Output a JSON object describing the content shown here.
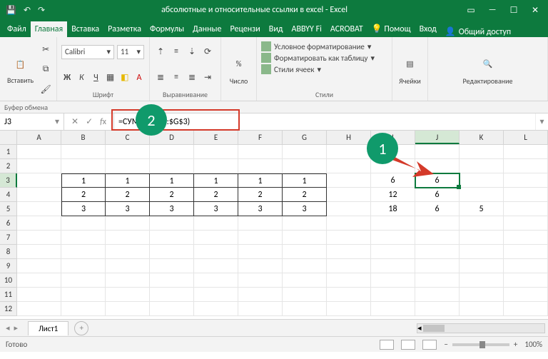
{
  "window": {
    "title": "абсолютные и относительные ссылки в excel - Excel"
  },
  "tabs": {
    "file": "Файл",
    "home": "Главная",
    "insert": "Вставка",
    "layout": "Разметка",
    "formulas": "Формулы",
    "data": "Данные",
    "review": "Рецензи",
    "view": "Вид",
    "abbyy": "ABBYY Fi",
    "acrobat": "ACROBAT",
    "help": "Помощ",
    "login": "Вход",
    "share": "Общий доступ"
  },
  "ribbon": {
    "clipboard": {
      "label": "Буфер обмена",
      "paste": "Вставить"
    },
    "font": {
      "label": "Шрифт",
      "name": "Calibri",
      "size": "11"
    },
    "alignment": {
      "label": "Выравнивание"
    },
    "number": {
      "label": "Число"
    },
    "styles": {
      "label": "Стили",
      "conditional": "Условное форматирование",
      "table": "Форматировать как таблицу",
      "cellstyles": "Стили ячеек"
    },
    "cells": {
      "label": "Ячейки"
    },
    "editing": {
      "label": "Редактирование"
    }
  },
  "namebox": "J3",
  "formula": "=СУММ($B$3:$G$3)",
  "columns": [
    "A",
    "B",
    "C",
    "D",
    "E",
    "F",
    "G",
    "H",
    "I",
    "J",
    "K",
    "L"
  ],
  "rows_count": 12,
  "grid": {
    "3": {
      "B": "1",
      "C": "1",
      "D": "1",
      "E": "1",
      "F": "1",
      "G": "1",
      "I": "6",
      "J": "6"
    },
    "4": {
      "B": "2",
      "C": "2",
      "D": "2",
      "E": "2",
      "F": "2",
      "G": "2",
      "I": "12",
      "J": "6"
    },
    "5": {
      "B": "3",
      "C": "3",
      "D": "3",
      "E": "3",
      "F": "3",
      "G": "3",
      "I": "18",
      "J": "6",
      "K": "5"
    }
  },
  "active_cell": "J3",
  "sheet": {
    "name": "Лист1"
  },
  "status": {
    "ready": "Готово",
    "zoom": "100%"
  },
  "badges": {
    "one": "1",
    "two": "2"
  }
}
